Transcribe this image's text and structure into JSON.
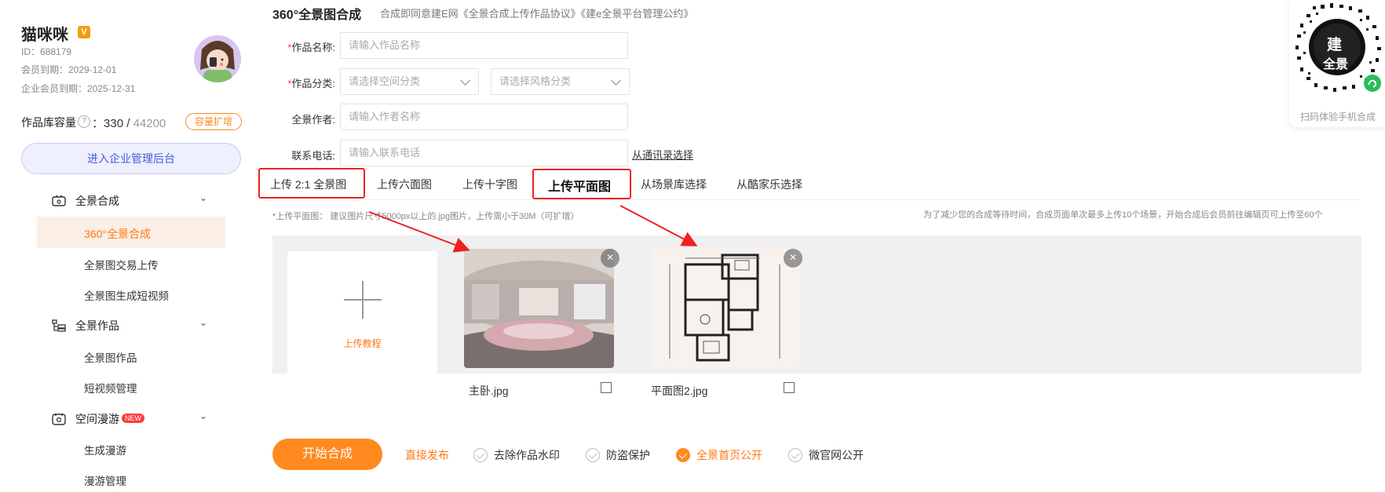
{
  "sidebar": {
    "username": "猫咪咪",
    "vip_badge": "V",
    "user_id": "ID：688179",
    "member_expiry": "会员到期：2029-12-01",
    "enterprise_expiry": "企业会员到期：2025-12-31",
    "capacity_label": "作品库容量",
    "capacity_help": "?",
    "capacity_used": "330",
    "capacity_total": "44200",
    "expand_button": "容量扩增",
    "enterprise_button": "进入企业管理后台",
    "nav": [
      {
        "label": "全景合成",
        "icon": "panorama-icon",
        "children": [
          "360°全景合成",
          "全景图交易上传",
          "全景图生成短视频"
        ]
      },
      {
        "label": "全景作品",
        "icon": "works-icon",
        "children": [
          "全景图作品",
          "短视频管理"
        ]
      },
      {
        "label": "空间漫游",
        "icon": "tour-icon",
        "badge": "NEW",
        "children": [
          "生成漫游",
          "漫游管理"
        ]
      }
    ],
    "active_item": "360°全景合成"
  },
  "main": {
    "title": "360°全景图合成",
    "agreement": "合成即同意建E网《全景合成上传作品协议》《建e全景平台管理公约》",
    "form": {
      "name_label": "作品名称:",
      "name_placeholder": "请输入作品名称",
      "category_label": "作品分类:",
      "space_placeholder": "请选择空间分类",
      "style_placeholder": "请选择风格分类",
      "author_label": "全景作者:",
      "author_placeholder": "请输入作者名称",
      "phone_label": "联系电话:",
      "phone_placeholder": "请输入联系电话",
      "contacts_link": "从通讯录选择"
    },
    "tabs": [
      "上传 2:1 全景图",
      "上传六面图",
      "上传十字图",
      "上传平面图",
      "从场景库选择",
      "从酷家乐选择"
    ],
    "active_tab": "上传平面图",
    "hint_left": "*上传平面图： 建议图片尺寸5000px以上的.jpg图片，上传需小于30M（可扩增）",
    "hint_right": "为了减少您的合成等待时间，合成页面单次最多上传10个场景，开始合成后会员前往编辑页可上传至60个",
    "add_card_label": "上传教程",
    "files": [
      {
        "name": "主卧.jpg"
      },
      {
        "name": "平面图2.jpg"
      }
    ],
    "start_button": "开始合成",
    "direct_publish": "直接发布",
    "options": [
      {
        "label": "去除作品水印",
        "checked": false
      },
      {
        "label": "防盗保护",
        "checked": false
      },
      {
        "label": "全景首页公开",
        "checked": true
      },
      {
        "label": "微官网公开",
        "checked": false
      }
    ]
  },
  "qr": {
    "center_text_1": "建",
    "center_text_2": "全景",
    "caption": "扫码体验手机合成"
  },
  "colors": {
    "accent": "#ff8a1f",
    "annotation_red": "#ee2222",
    "enterprise_blue": "#4a5cd8"
  }
}
